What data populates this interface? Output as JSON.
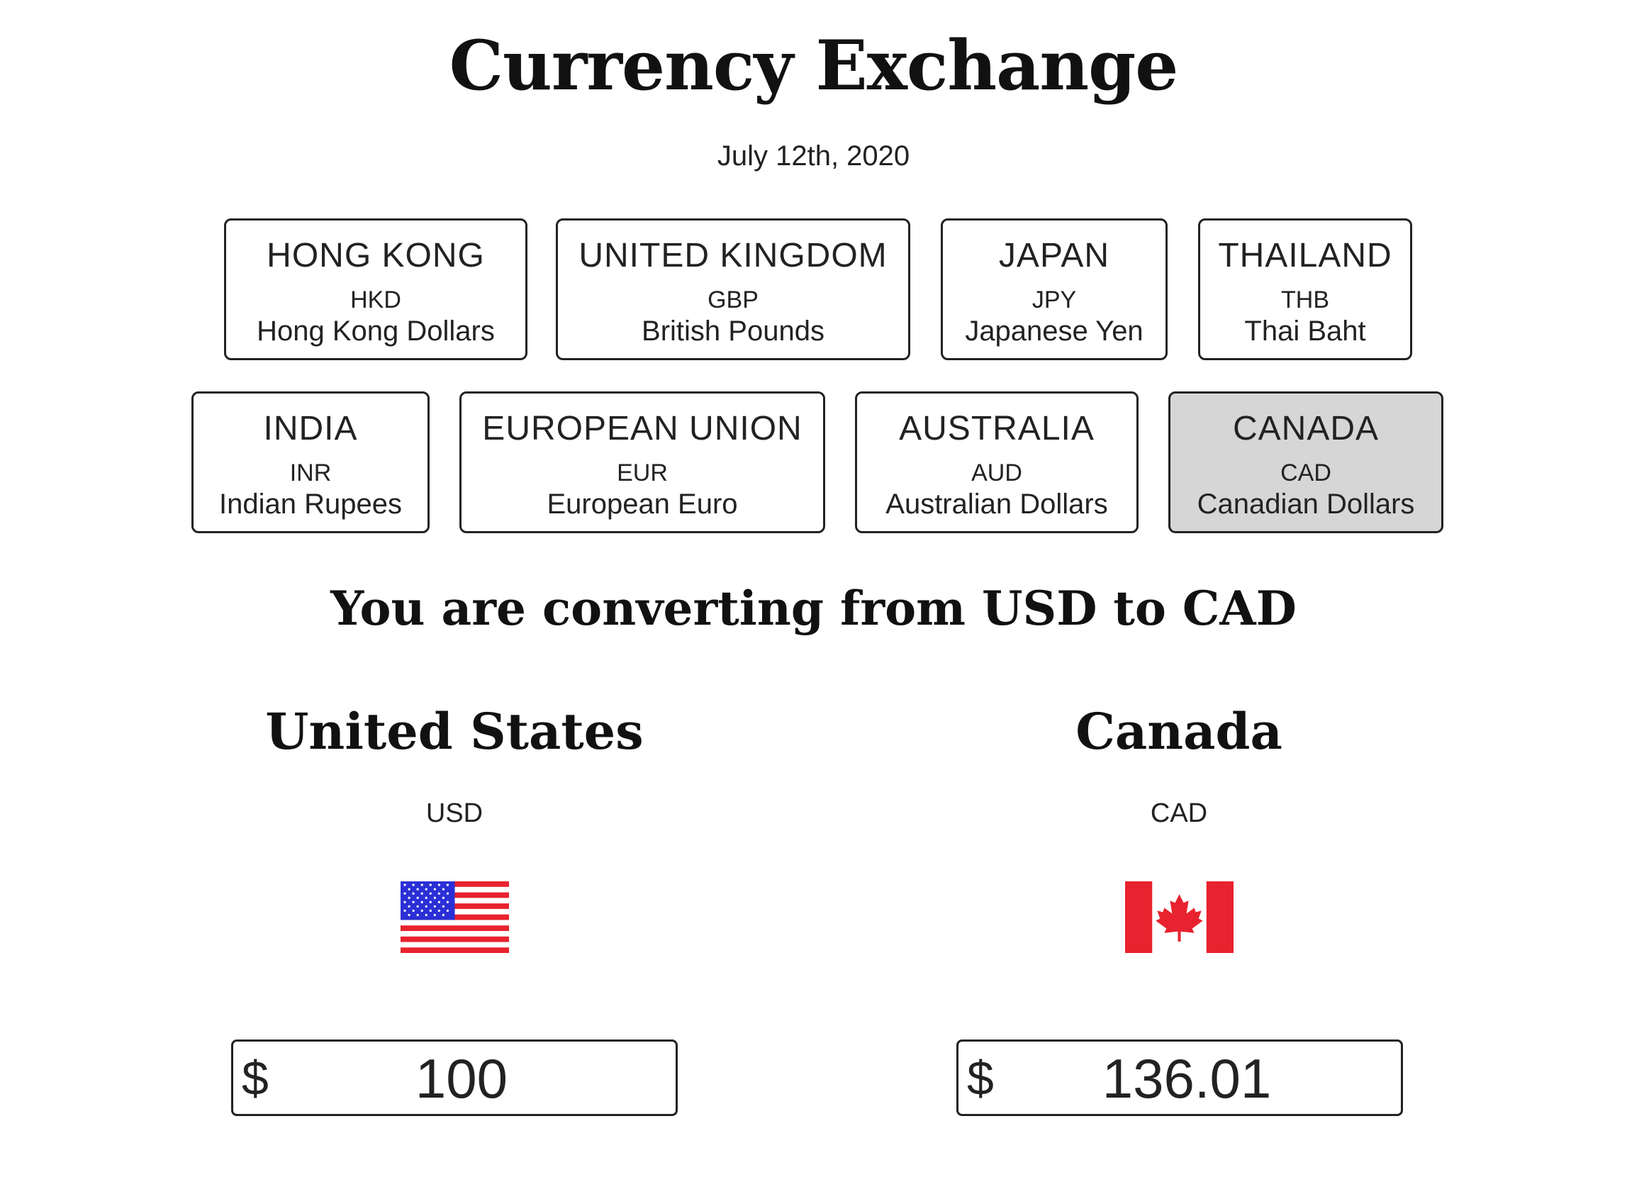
{
  "header": {
    "title": "Currency Exchange",
    "date": "July 12th, 2020"
  },
  "currencies": [
    {
      "country": "HONG KONG",
      "code": "HKD",
      "name": "Hong Kong Dollars",
      "selected": false
    },
    {
      "country": "UNITED KINGDOM",
      "code": "GBP",
      "name": "British Pounds",
      "selected": false
    },
    {
      "country": "JAPAN",
      "code": "JPY",
      "name": "Japanese Yen",
      "selected": false
    },
    {
      "country": "THAILAND",
      "code": "THB",
      "name": "Thai Baht",
      "selected": false
    },
    {
      "country": "INDIA",
      "code": "INR",
      "name": "Indian Rupees",
      "selected": false
    },
    {
      "country": "EUROPEAN UNION",
      "code": "EUR",
      "name": "European Euro",
      "selected": false
    },
    {
      "country": "AUSTRALIA",
      "code": "AUD",
      "name": "Australian Dollars",
      "selected": true
    },
    {
      "country": "CANADA",
      "code": "CAD",
      "name": "Canadian Dollars",
      "selected": true
    }
  ],
  "conversion": {
    "heading": "You are converting from USD to CAD",
    "from": {
      "country": "United States",
      "code": "USD",
      "symbol": "$",
      "amount": "100",
      "flag_icon": "us-flag-icon"
    },
    "to": {
      "country": "Canada",
      "code": "CAD",
      "symbol": "$",
      "amount": "136.01",
      "flag_icon": "canada-flag-icon"
    }
  },
  "colors": {
    "selected_card_bg": "#d6d6d6",
    "border": "#222222",
    "flag_red": "#e8222e",
    "flag_blue": "#2b2fd6"
  }
}
